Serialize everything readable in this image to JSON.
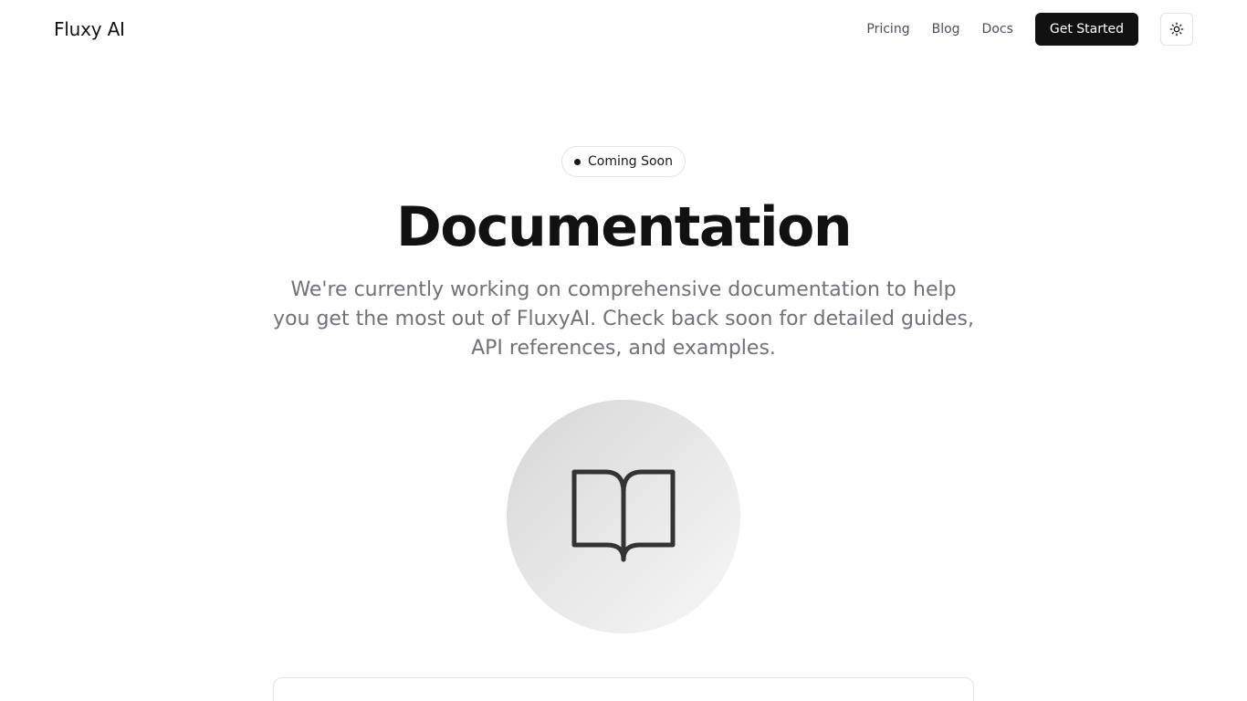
{
  "header": {
    "brand": "Fluxy AI",
    "nav": [
      {
        "label": "Pricing"
      },
      {
        "label": "Blog"
      },
      {
        "label": "Docs"
      }
    ],
    "cta_label": "Get Started",
    "theme_toggle_icon": "sun-icon"
  },
  "main": {
    "badge": "Coming Soon",
    "title": "Documentation",
    "subtitle": "We're currently working on comprehensive documentation to help you get the most out of FluxyAI. Check back soon for detailed guides, API references, and examples.",
    "illustration_icon": "book-open-icon"
  },
  "colors": {
    "primary": "#111111",
    "muted_text": "#71717a",
    "border": "#e4e4e7"
  }
}
